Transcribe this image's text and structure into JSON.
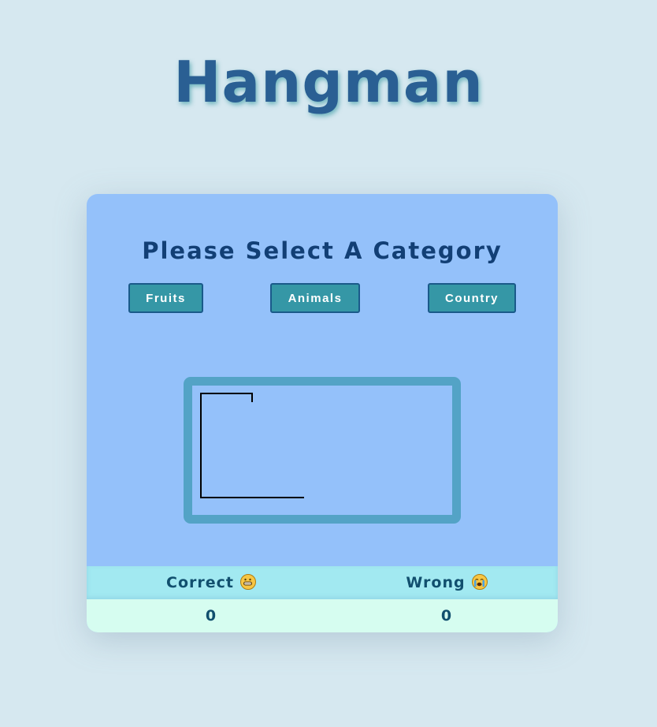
{
  "app": {
    "title": "Hangman"
  },
  "category_panel": {
    "prompt": "Please Select A Category",
    "buttons": [
      {
        "label": "Fruits"
      },
      {
        "label": "Animals"
      },
      {
        "label": "Country"
      }
    ]
  },
  "scoreboard": {
    "correct_label": "Correct",
    "correct_icon": "grinning-face-icon",
    "wrong_label": "Wrong",
    "wrong_icon": "crying-face-icon",
    "correct_value": "0",
    "wrong_value": "0"
  },
  "colors": {
    "background": "#d6e8f0",
    "card": "#94c1fa",
    "button": "#3597a6",
    "board_border": "#53a3c6",
    "score_head": "#a2e9f1",
    "score_body": "#d6fdf0"
  }
}
